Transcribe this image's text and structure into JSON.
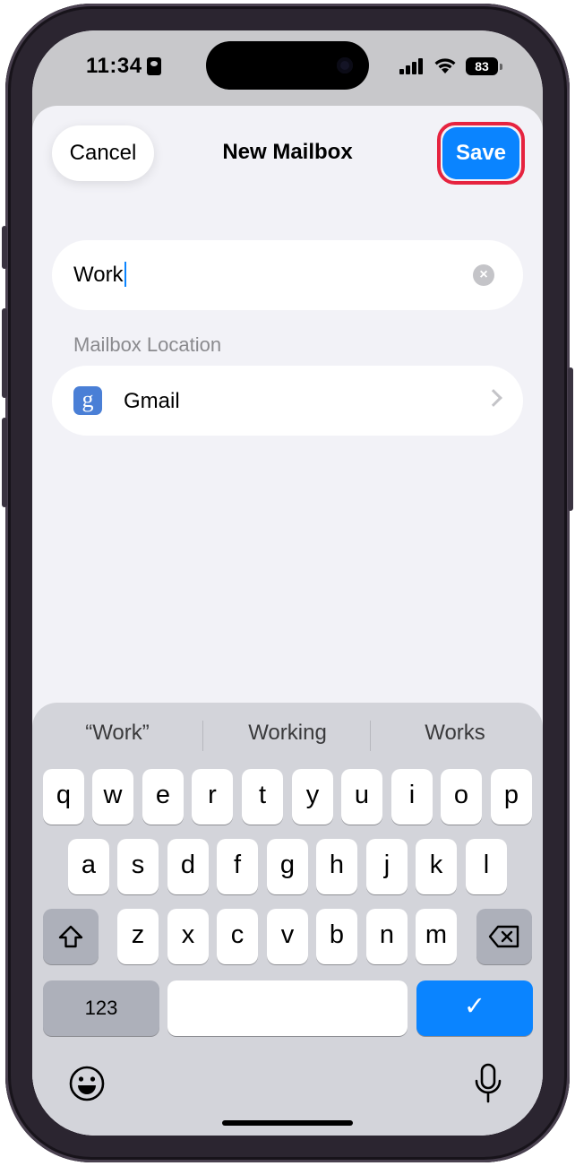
{
  "status_bar": {
    "time": "11:34",
    "battery": "83"
  },
  "nav": {
    "cancel_label": "Cancel",
    "title": "New Mailbox",
    "save_label": "Save"
  },
  "form": {
    "name_value": "Work",
    "section_header": "Mailbox Location",
    "location_label": "Gmail",
    "location_icon_glyph": "g"
  },
  "keyboard": {
    "suggestions": [
      "“Work”",
      "Working",
      "Works"
    ],
    "rows": [
      [
        "q",
        "w",
        "e",
        "r",
        "t",
        "y",
        "u",
        "i",
        "o",
        "p"
      ],
      [
        "a",
        "s",
        "d",
        "f",
        "g",
        "h",
        "j",
        "k",
        "l"
      ],
      [
        "z",
        "x",
        "c",
        "v",
        "b",
        "n",
        "m"
      ]
    ],
    "numbers_label": "123",
    "done_glyph": "✓"
  },
  "colors": {
    "accent": "#0a84ff",
    "highlight_ring": "#e6233f",
    "sheet_bg": "#f2f2f7"
  }
}
